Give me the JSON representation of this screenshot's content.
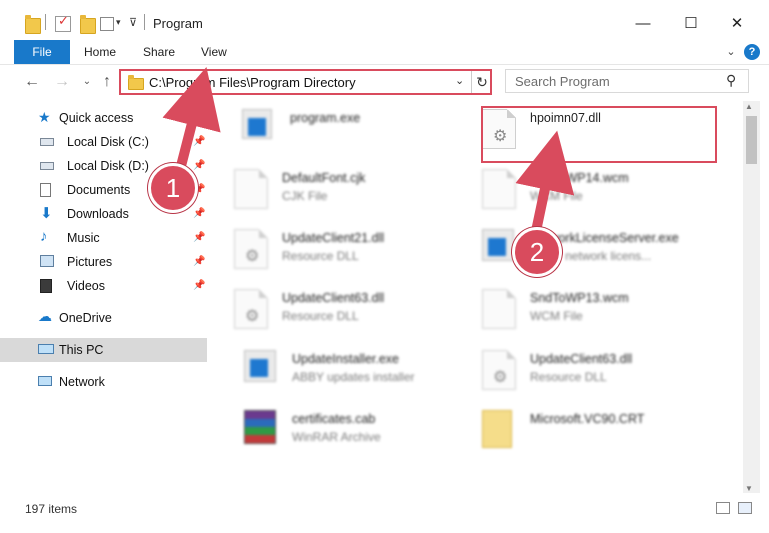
{
  "window": {
    "title": "Program",
    "minimize": "—",
    "maximize": "☐",
    "close": "✕"
  },
  "ribbon": {
    "file": "File",
    "home": "Home",
    "share": "Share",
    "view": "View",
    "help": "?"
  },
  "address": {
    "path": "C:\\Program Files\\Program Directory"
  },
  "search": {
    "placeholder": "Search Program"
  },
  "sidebar": {
    "quick_access": "Quick access",
    "items": [
      {
        "label": "Local Disk (C:)"
      },
      {
        "label": "Local Disk (D:)"
      },
      {
        "label": "Documents"
      },
      {
        "label": "Downloads"
      },
      {
        "label": "Music"
      },
      {
        "label": "Pictures"
      },
      {
        "label": "Videos"
      }
    ],
    "onedrive": "OneDrive",
    "thispc": "This PC",
    "network": "Network"
  },
  "files": {
    "left": [
      {
        "name": "program.exe",
        "type": ""
      },
      {
        "name": "DefaultFont.cjk",
        "type": "CJK File"
      },
      {
        "name": "UpdateClient21.dll",
        "type": "Resource DLL"
      },
      {
        "name": "UpdateClient63.dll",
        "type": "Resource DLL"
      },
      {
        "name": "UpdateInstaller.exe",
        "type": "ABBY updates installer"
      },
      {
        "name": "certificates.cab",
        "type": "WinRAR Archive"
      }
    ],
    "right": [
      {
        "name": "hpoimn07.dll",
        "type": ""
      },
      {
        "name": "SndToWP14.wcm",
        "type": "WCM File"
      },
      {
        "name": "NetworkLicenseServer.exe",
        "type": "ABBY network licens..."
      },
      {
        "name": "SndToWP13.wcm",
        "type": "WCM File"
      },
      {
        "name": "UpdateClient63.dll",
        "type": "Resource DLL"
      },
      {
        "name": "Microsoft.VC90.CRT",
        "type": ""
      }
    ]
  },
  "status": {
    "items": "197 items"
  },
  "callouts": {
    "one": "1",
    "two": "2"
  },
  "colors": {
    "accent": "#1979ca",
    "highlight": "#d94b5d"
  }
}
